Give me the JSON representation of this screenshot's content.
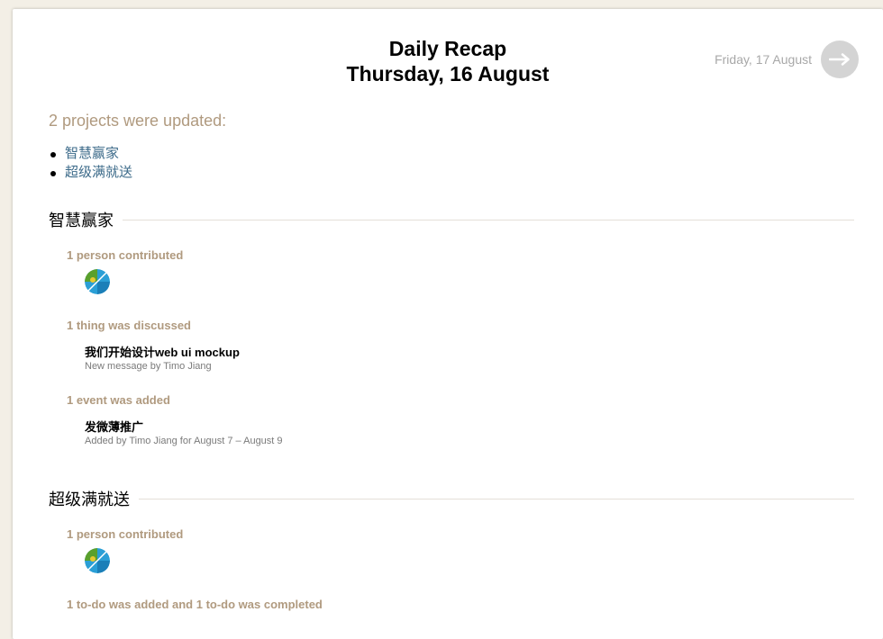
{
  "header": {
    "title_line1": "Daily Recap",
    "title_line2": "Thursday, 16 August",
    "next_day_label": "Friday, 17 August"
  },
  "summary": {
    "text": "2 projects were updated:",
    "links": [
      "智慧赢家",
      "超级满就送"
    ]
  },
  "projects": [
    {
      "name": "智慧赢家",
      "contributors_label": "1 person contributed",
      "discussed_label": "1 thing was discussed",
      "discussion_title": "我们开始设计web ui mockup",
      "discussion_meta": "New message by Timo Jiang",
      "events_label": "1 event was added",
      "event_title": "发微薄推广",
      "event_meta": "Added by Timo Jiang for August 7 – August 9"
    },
    {
      "name": "超级满就送",
      "contributors_label": "1 person contributed",
      "todos_label": "1 to-do was added and 1 to-do was completed"
    }
  ],
  "colors": {
    "accent_tan": "#b09a7f",
    "link_blue": "#3d6b8a",
    "background": "#f3efe6",
    "arrow_button": "#d4d4d4"
  }
}
